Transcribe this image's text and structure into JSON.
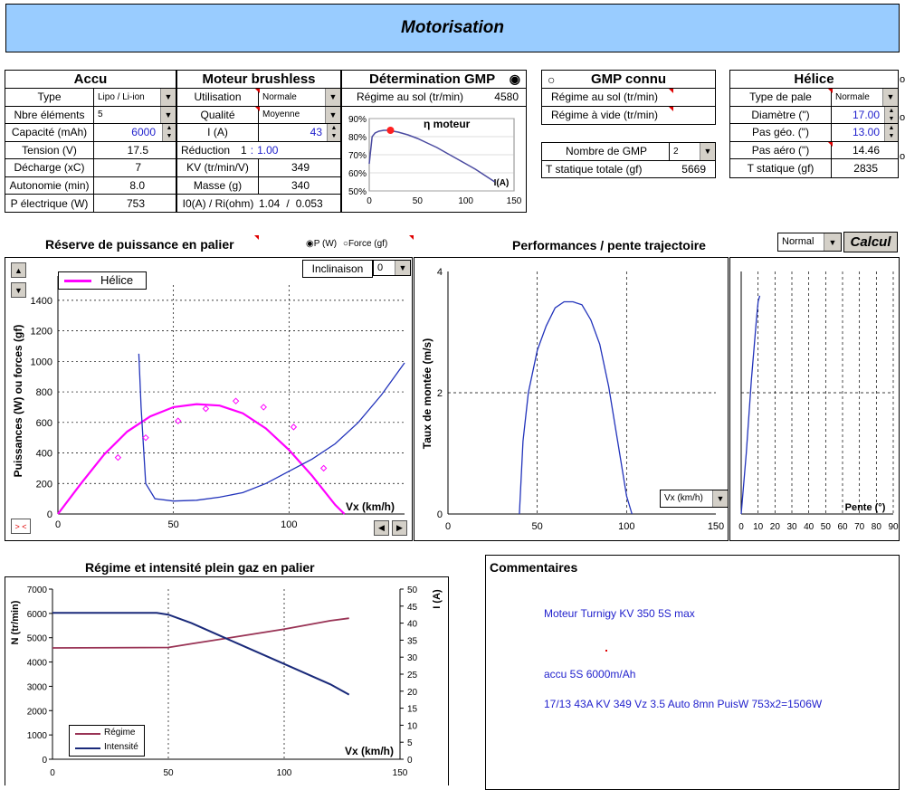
{
  "title": "Motorisation",
  "accu": {
    "header": "Accu",
    "rows": [
      {
        "label": "Type",
        "value": "Lipo / Li-ion"
      },
      {
        "label": "Nbre éléments",
        "value": "5"
      },
      {
        "label": "Capacité (mAh)",
        "value": "6000"
      },
      {
        "label": "Tension (V)",
        "value": "17.5"
      },
      {
        "label": "Décharge (xC)",
        "value": "7"
      },
      {
        "label": "Autonomie (min)",
        "value": "8.0"
      },
      {
        "label": "P électrique (W)",
        "value": "753"
      }
    ]
  },
  "moteur": {
    "header": "Moteur brushless",
    "rows": [
      {
        "label": "Utilisation",
        "value": "Normale"
      },
      {
        "label": "Qualité",
        "value": "Moyenne"
      },
      {
        "label": "I (A)",
        "value": "43"
      },
      {
        "label": "Réduction",
        "value": "1",
        "value2": "1.00"
      },
      {
        "label": "KV (tr/min/V)",
        "value": "349"
      },
      {
        "label": "Masse (g)",
        "value": "340"
      },
      {
        "label": "I0(A) / Ri(ohm)",
        "value": "1.04",
        "sep": "/",
        "value2": "0.053"
      }
    ],
    "reduction_sep": ":"
  },
  "gmp_det": {
    "header": "Détermination GMP",
    "radio_symbol": "◉",
    "regime_label": "Régime au sol (tr/min)",
    "regime_value": "4580",
    "chart_title": "η moteur",
    "y_ticks": [
      "90%",
      "80%",
      "70%",
      "60%",
      "50%"
    ],
    "x_ticks": [
      "0",
      "50",
      "100",
      "150"
    ],
    "x_label": "I(A)"
  },
  "gmp_connu": {
    "header": "GMP connu",
    "radio_symbol": "○",
    "rows": [
      "Régime au sol  (tr/min)",
      "Régime à vide  (tr/min)"
    ],
    "nombre_label": "Nombre de GMP",
    "nombre_value": "2",
    "tstat_label": "T statique totale (gf)",
    "tstat_value": "5669"
  },
  "helice": {
    "header": "Hélice",
    "rows": [
      {
        "label": "Type de pale",
        "value": "Normale"
      },
      {
        "label": "Diamètre (\")",
        "value": "17.00"
      },
      {
        "label": "Pas géo. (\")",
        "value": "13.00"
      },
      {
        "label": "Pas aéro (\")",
        "value": "14.46"
      },
      {
        "label": "T statique (gf)",
        "value": "2835"
      }
    ],
    "edge_chars": [
      "o",
      "o",
      "o"
    ]
  },
  "reserve": {
    "title": "Réserve de puissance en palier",
    "radio_p": "P (W)",
    "radio_f": "Force (gf)",
    "radio_on": "◉",
    "radio_off": "○",
    "inclinaison_label": "Inclinaison",
    "inclinaison_value": "0",
    "legend": "Hélice",
    "y_label": "Puissances (W) ou forces (gf)",
    "x_label": "Vx (km/h)",
    "y_ticks": [
      "0",
      "200",
      "400",
      "600",
      "800",
      "1000",
      "1200",
      "1400"
    ],
    "x_ticks": [
      "0",
      "50",
      "100"
    ],
    "zoom_label": "> <"
  },
  "performances": {
    "title": "Performances / pente trajectoire",
    "mode_value": "Normal",
    "calcul_label": "Calcul",
    "y_label": "Taux de montée (m/s)",
    "y_ticks": [
      "0",
      "2",
      "4"
    ],
    "x_ticks": [
      "0",
      "50",
      "100",
      "150"
    ],
    "x_select": "Vx (km/h)",
    "pente_label": "Pente (°)",
    "pente_ticks": [
      "0",
      "10",
      "20",
      "30",
      "40",
      "50",
      "60",
      "70",
      "80",
      "90"
    ]
  },
  "regime": {
    "title": "Régime et intensité plein gaz en palier",
    "y_label": "N (tr/min)",
    "y2_label": "I (A)",
    "x_label": "Vx (km/h)",
    "y_ticks": [
      "0",
      "1000",
      "2000",
      "3000",
      "4000",
      "5000",
      "6000",
      "7000"
    ],
    "y2_ticks": [
      "0",
      "5",
      "10",
      "15",
      "20",
      "25",
      "30",
      "35",
      "40",
      "45",
      "50"
    ],
    "x_ticks": [
      "0",
      "50",
      "100",
      "150"
    ],
    "legend": [
      "Régime",
      "Intensité"
    ]
  },
  "commentaires": {
    "title": "Commentaires",
    "lines": [
      "Moteur Turnigy KV 350 5S max",
      "accu 5S 6000m/Ah",
      "17/13 43A KV 349 Vz 3.5 Auto 8mn  PuisW 753x2=1506W"
    ]
  },
  "colors": {
    "header_bg": "#99ccff",
    "blue_text": "#1f1fcc",
    "helice_curve": "#ff00ff",
    "power_curve": "#2233bb",
    "regime_curve": "#993355",
    "intensite_curve": "#1a2a7a"
  },
  "chart_data": [
    {
      "type": "line",
      "title": "η moteur",
      "xlabel": "I(A)",
      "xlim": [
        0,
        150
      ],
      "ylim": [
        50,
        90
      ],
      "series": [
        {
          "x": [
            0,
            3,
            6,
            10,
            15,
            20,
            25,
            30,
            40,
            50,
            60,
            70,
            80,
            90,
            100,
            110,
            120,
            130
          ],
          "y": [
            65,
            80,
            82,
            83,
            83.5,
            83.5,
            83,
            82.5,
            81,
            79,
            76.5,
            74,
            71,
            68,
            65,
            62,
            58.5,
            55
          ]
        }
      ],
      "marker": {
        "x": 22,
        "y": 83.5
      }
    },
    {
      "type": "line",
      "title": "Réserve de puissance en palier",
      "xlabel": "Vx (km/h)",
      "ylabel": "Puissances (W) ou forces (gf)",
      "xlim": [
        0,
        150
      ],
      "ylim": [
        0,
        1500
      ],
      "legend": "top-left",
      "series": [
        {
          "name": "Hélice",
          "x": [
            0,
            10,
            20,
            30,
            40,
            50,
            60,
            70,
            80,
            90,
            100,
            110,
            120,
            124
          ],
          "y": [
            0,
            200,
            390,
            540,
            640,
            700,
            720,
            710,
            660,
            560,
            420,
            250,
            60,
            0
          ]
        },
        {
          "x": [
            35,
            36,
            38,
            42,
            50,
            60,
            70,
            80,
            90,
            100,
            110,
            120,
            130,
            140,
            150
          ],
          "y": [
            1050,
            700,
            200,
            100,
            85,
            90,
            110,
            140,
            200,
            280,
            360,
            460,
            600,
            780,
            990
          ]
        }
      ],
      "points": {
        "x": [
          26,
          38,
          52,
          64,
          77,
          89,
          102,
          115
        ],
        "y": [
          370,
          500,
          610,
          690,
          740,
          700,
          570,
          300
        ]
      }
    },
    {
      "type": "line",
      "title": "Performances / pente trajectoire",
      "xlabel": "Vx (km/h)",
      "ylabel": "Taux de montée (m/s)",
      "xlim": [
        0,
        150
      ],
      "ylim": [
        0,
        4
      ],
      "series": [
        {
          "x": [
            40,
            42,
            45,
            50,
            55,
            60,
            65,
            70,
            75,
            80,
            85,
            90,
            95,
            100,
            103
          ],
          "y": [
            0,
            1.2,
            2,
            2.7,
            3.1,
            3.4,
            3.5,
            3.5,
            3.45,
            3.2,
            2.8,
            2.1,
            1.2,
            0.3,
            0
          ]
        }
      ]
    },
    {
      "type": "line",
      "xlabel": "Pente (°)",
      "xlim": [
        0,
        90
      ],
      "ylim": [
        0,
        4
      ],
      "series": [
        {
          "x": [
            0,
            3,
            6,
            9,
            10,
            11
          ],
          "y": [
            0,
            1,
            2.2,
            3.2,
            3.5,
            3.6
          ]
        }
      ]
    },
    {
      "type": "line",
      "title": "Régime et intensité plein gaz en palier",
      "xlabel": "Vx (km/h)",
      "ylabel": "N (tr/min)",
      "y2label": "I (A)",
      "xlim": [
        0,
        150
      ],
      "ylim": [
        0,
        7000
      ],
      "y2lim": [
        0,
        50
      ],
      "legend": "bottom-left",
      "series": [
        {
          "name": "Régime",
          "axis": "left",
          "x": [
            0,
            50,
            60,
            80,
            100,
            120,
            128
          ],
          "y": [
            4580,
            4600,
            4750,
            5050,
            5350,
            5700,
            5800
          ]
        },
        {
          "name": "Intensité",
          "axis": "right",
          "x": [
            0,
            45,
            50,
            60,
            80,
            100,
            120,
            128
          ],
          "y": [
            43,
            43,
            42.5,
            40,
            34,
            28,
            22,
            19
          ]
        }
      ]
    }
  ]
}
